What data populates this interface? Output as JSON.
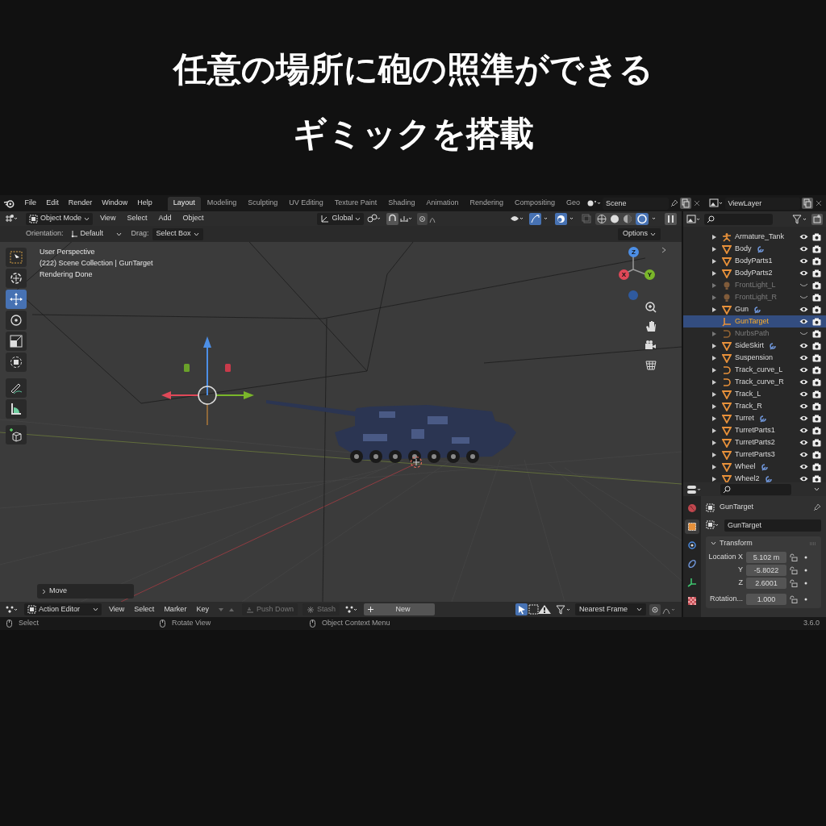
{
  "headline": [
    "任意の場所に砲の照準ができる",
    "ギミックを搭載"
  ],
  "menu": [
    "File",
    "Edit",
    "Render",
    "Window",
    "Help"
  ],
  "workspaces": [
    {
      "label": "Layout",
      "selected": true
    },
    {
      "label": "Modeling",
      "selected": false
    },
    {
      "label": "Sculpting",
      "selected": false
    },
    {
      "label": "UV Editing",
      "selected": false
    },
    {
      "label": "Texture Paint",
      "selected": false
    },
    {
      "label": "Shading",
      "selected": false
    },
    {
      "label": "Animation",
      "selected": false
    },
    {
      "label": "Rendering",
      "selected": false
    },
    {
      "label": "Compositing",
      "selected": false
    },
    {
      "label": "Geo",
      "selected": false
    }
  ],
  "scene": "Scene",
  "view_layer": "ViewLayer",
  "viewport_header": {
    "mode": "Object Mode",
    "menus": [
      "View",
      "Select",
      "Add",
      "Object"
    ],
    "orientation": "Global"
  },
  "tool_settings": {
    "orientation_label": "Orientation:",
    "orientation": "Default",
    "drag_label": "Drag:",
    "drag": "Select Box",
    "options": "Options"
  },
  "tools": [
    {
      "kind": "select",
      "selected": false
    },
    {
      "kind": "cursor",
      "selected": false
    },
    {
      "kind": "move",
      "selected": true
    },
    {
      "kind": "rotate",
      "selected": false
    },
    {
      "kind": "scale",
      "selected": false
    },
    {
      "kind": "transform",
      "selected": false
    },
    {
      "kind": "annotate",
      "selected": false
    },
    {
      "kind": "measure",
      "selected": false
    },
    {
      "kind": "add",
      "selected": false
    }
  ],
  "overlay_text": [
    "User Perspective",
    "(222) Scene Collection | GunTarget",
    "Rendering Done"
  ],
  "axes": [
    "X",
    "Y",
    "Z"
  ],
  "last_operator": "Move",
  "outliner": [
    {
      "name": "Armature_Tank",
      "kind": "armature",
      "selected": false,
      "hidden": false,
      "modifiers": false
    },
    {
      "name": "Body",
      "kind": "mesh",
      "selected": false,
      "hidden": false,
      "modifiers": true
    },
    {
      "name": "BodyParts1",
      "kind": "mesh",
      "selected": false,
      "hidden": false,
      "modifiers": false
    },
    {
      "name": "BodyParts2",
      "kind": "mesh",
      "selected": false,
      "hidden": false,
      "modifiers": false
    },
    {
      "name": "FrontLight_L",
      "kind": "light",
      "selected": false,
      "hidden": true,
      "modifiers": false
    },
    {
      "name": "FrontLight_R",
      "kind": "light",
      "selected": false,
      "hidden": true,
      "modifiers": false
    },
    {
      "name": "Gun",
      "kind": "mesh",
      "selected": false,
      "hidden": false,
      "modifiers": true
    },
    {
      "name": "GunTarget",
      "kind": "empty",
      "selected": true,
      "hidden": false,
      "modifiers": false
    },
    {
      "name": "NurbsPath",
      "kind": "curve",
      "selected": false,
      "hidden": true,
      "modifiers": false
    },
    {
      "name": "SideSkirt",
      "kind": "mesh",
      "selected": false,
      "hidden": false,
      "modifiers": true
    },
    {
      "name": "Suspension",
      "kind": "mesh",
      "selected": false,
      "hidden": false,
      "modifiers": false
    },
    {
      "name": "Track_curve_L",
      "kind": "curve",
      "selected": false,
      "hidden": false,
      "modifiers": false
    },
    {
      "name": "Track_curve_R",
      "kind": "curve",
      "selected": false,
      "hidden": false,
      "modifiers": false
    },
    {
      "name": "Track_L",
      "kind": "mesh",
      "selected": false,
      "hidden": false,
      "modifiers": false
    },
    {
      "name": "Track_R",
      "kind": "mesh",
      "selected": false,
      "hidden": false,
      "modifiers": false
    },
    {
      "name": "Turret",
      "kind": "mesh",
      "selected": false,
      "hidden": false,
      "modifiers": true
    },
    {
      "name": "TurretParts1",
      "kind": "mesh",
      "selected": false,
      "hidden": false,
      "modifiers": false
    },
    {
      "name": "TurretParts2",
      "kind": "mesh",
      "selected": false,
      "hidden": false,
      "modifiers": false
    },
    {
      "name": "TurretParts3",
      "kind": "mesh",
      "selected": false,
      "hidden": false,
      "modifiers": false
    },
    {
      "name": "Wheel",
      "kind": "mesh",
      "selected": false,
      "hidden": false,
      "modifiers": true
    },
    {
      "name": "Wheel2",
      "kind": "mesh",
      "selected": false,
      "hidden": false,
      "modifiers": true
    }
  ],
  "properties": {
    "tabs": [
      {
        "kind": "world",
        "selected": false
      },
      {
        "kind": "object",
        "selected": true
      },
      {
        "kind": "physics",
        "selected": false
      },
      {
        "kind": "constraints",
        "selected": false
      },
      {
        "kind": "data",
        "selected": false
      },
      {
        "kind": "texture",
        "selected": false
      }
    ],
    "object_name": "GunTarget",
    "data_name": "GunTarget",
    "panel": "Transform",
    "fields": [
      {
        "label": "Location X",
        "value": "5.102 m"
      },
      {
        "label": "Y",
        "value": "-5.8022"
      },
      {
        "label": "Z",
        "value": "2.6001"
      },
      {
        "label": "Rotation...",
        "value": "1.000"
      }
    ]
  },
  "action_editor": {
    "mode": "Action Editor",
    "menus": [
      "View",
      "Select",
      "Marker",
      "Key"
    ],
    "push_down": "Push Down",
    "stash": "Stash",
    "new": "New",
    "snapping": "Nearest Frame"
  },
  "status_bar": {
    "hints": [
      "Select",
      "Rotate View",
      "Object Context Menu"
    ],
    "version": "3.6.0"
  }
}
